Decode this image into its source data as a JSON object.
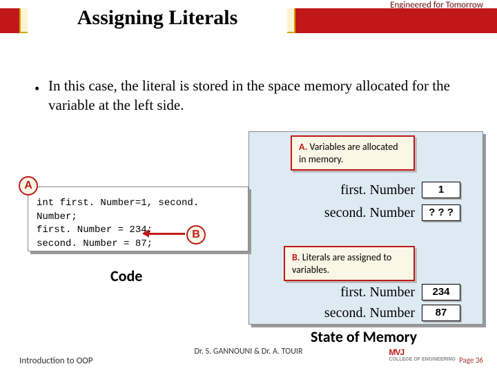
{
  "header": {
    "tagline": "Engineered for Tomorrow",
    "title": "Assigning Literals"
  },
  "bullet": {
    "text": "In this case, the literal is stored in the space memory allocated for the variable at the left side."
  },
  "callout_a": {
    "tag": "A.",
    "text": "Variables are allocated in memory."
  },
  "callout_b": {
    "tag": "B.",
    "text": "Literals are assigned to variables."
  },
  "memory": {
    "rows_before": [
      {
        "name": "first. Number",
        "value": "1"
      },
      {
        "name": "second. Number",
        "value": "? ? ?"
      }
    ],
    "rows_after": [
      {
        "name": "first. Number",
        "value": "234"
      },
      {
        "name": "second. Number",
        "value": "87"
      }
    ]
  },
  "code": {
    "tag": "A",
    "b_tag": "B",
    "line1": "int first. Number=1, second. Number;",
    "line2": "first. Number  = 234;",
    "line3": "second. Number = 87;"
  },
  "labels": {
    "code": "Code",
    "memory": "State of Memory"
  },
  "footer": {
    "left": "Introduction to OOP",
    "center": "Dr. S. GANNOUNI & Dr. A. TOUIR",
    "right": "Page 36",
    "logo_main": "MVJ",
    "logo_sub": "COLLEGE OF ENGINEERING"
  }
}
